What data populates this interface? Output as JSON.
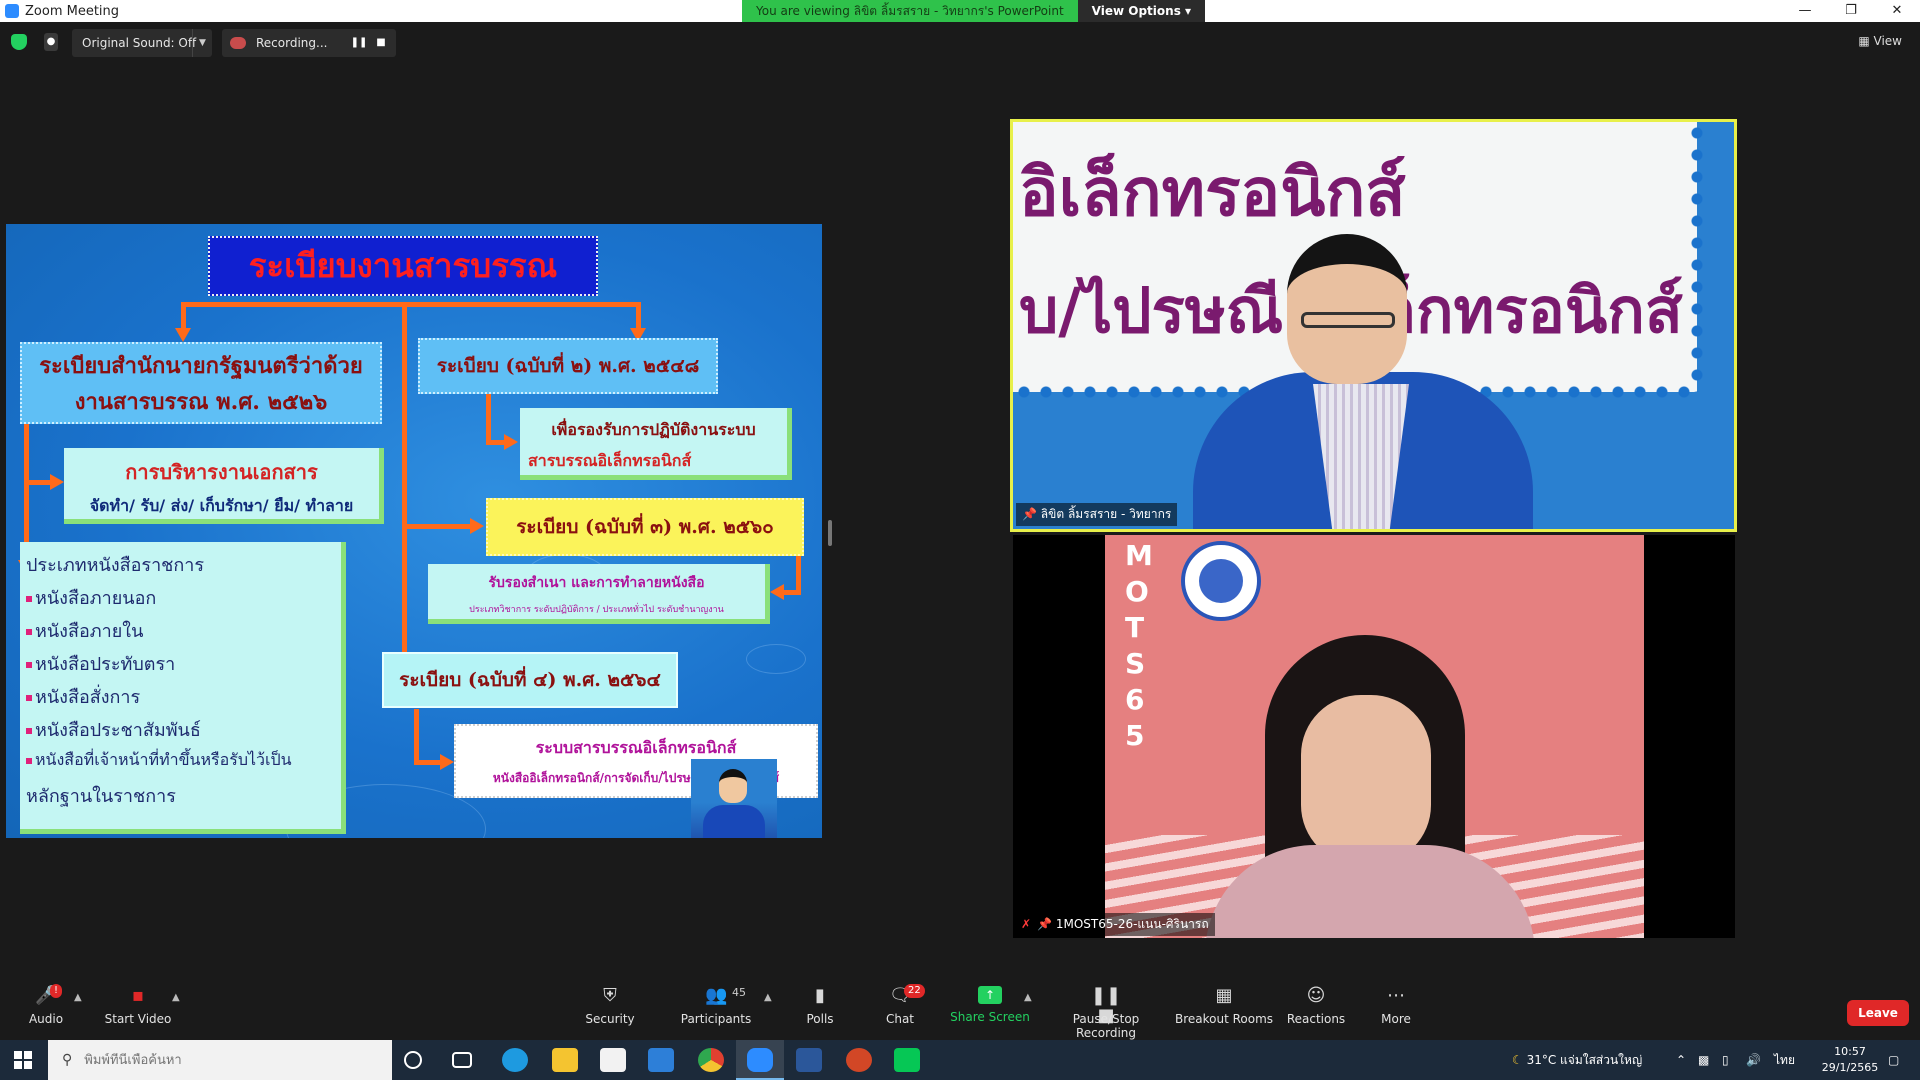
{
  "window": {
    "title": "Zoom Meeting",
    "viewing_banner": "You are viewing ลิขิต ลิ้มรสราย - วิทยากร's PowerPoint",
    "view_options": "View Options",
    "minimize": "—",
    "restore": "❐",
    "close": "✕"
  },
  "topbar": {
    "original_sound": "Original Sound: Off",
    "recording": "Recording...",
    "view": "View"
  },
  "slide": {
    "title": "ระเบียบงานสารบรรณ",
    "box_regulation_main": "ระเบียบสำนักนายกรัฐมนตรีว่าด้วย งานสารบรรณ พ.ศ. ๒๕๒๖",
    "box_doc_admin_title": "การบริหารงานเอกสาร",
    "box_doc_admin_sub": "จัดทำ/ รับ/ ส่ง/ เก็บรักษา/ ยืม/ ทำลาย",
    "doc_types_header": "ประเภทหนังสือราชการ",
    "doc_types": [
      "หนังสือภายนอก",
      "หนังสือภายใน",
      "หนังสือประทับตรา",
      "หนังสือสั่งการ",
      "หนังสือประชาสัมพันธ์",
      "หนังสือที่เจ้าหน้าที่ทำขึ้นหรือรับไว้เป็น"
    ],
    "doc_types_tail": "หลักฐานในราชการ",
    "box_v2": "ระเบียบ (ฉบับที่ ๒) พ.ศ. ๒๕๔๘",
    "box_v2_detail_1": "เพื่อรองรับการปฏิบัติงานระบบ",
    "box_v2_detail_2": "สารบรรณอิเล็กทรอนิกส์",
    "box_v3": "ระเบียบ (ฉบับที่ ๓) พ.ศ. ๒๕๖๐",
    "box_v3_detail_1": "รับรองสำเนา และการทำลายหนังสือ",
    "box_v3_detail_2": "ประเภทวิชาการ ระดับปฏิบัติการ / ประเภททั่วไป ระดับชำนาญงาน",
    "box_v4": "ระเบียบ (ฉบับที่ ๔) พ.ศ. ๒๕๖๔",
    "box_v4_detail_1": "ระบบสารบรรณอิเล็กทรอนิกส์",
    "box_v4_detail_2": "หนังสืออิเล็กทรอนิกส์/การจัดเก็บ/ไปรษณีย์อิเล็กทรอนิกส์"
  },
  "tiles": {
    "speaker_bg_line1": "อิเล็กทรอนิกส์",
    "speaker_bg_line2": "บ/ไปรษณีย์อิเล็กทรอนิกส์",
    "speaker_name": "ลิขิต ลิ้มรสราย - วิทยากร",
    "participant_name": "1MOST65-26-แนน-ศิรินารถ",
    "participant_bg_letters": [
      "M",
      "O",
      "T",
      "S",
      "6",
      "5"
    ]
  },
  "toolbar": {
    "audio": "Audio",
    "audio_badge": "!",
    "start_video": "Start Video",
    "security": "Security",
    "participants": "Participants",
    "participants_count": "45",
    "polls": "Polls",
    "chat": "Chat",
    "chat_badge": "22",
    "share_screen": "Share Screen",
    "pause_stop_recording": "Pause/Stop Recording",
    "breakout_rooms": "Breakout Rooms",
    "reactions": "Reactions",
    "more": "More",
    "leave": "Leave"
  },
  "taskbar": {
    "search_placeholder": "พิมพ์ที่นี่เพื่อค้นหา",
    "weather": "31°C แจ่มใสส่วนใหญ่",
    "lang": "ไทย",
    "time": "10:57",
    "date": "29/1/2565"
  },
  "colors": {
    "zoom_green": "#23d160",
    "leave_red": "#e02828",
    "active_speaker_border": "#e8f04a",
    "slide_orange": "#ff6a1a"
  }
}
